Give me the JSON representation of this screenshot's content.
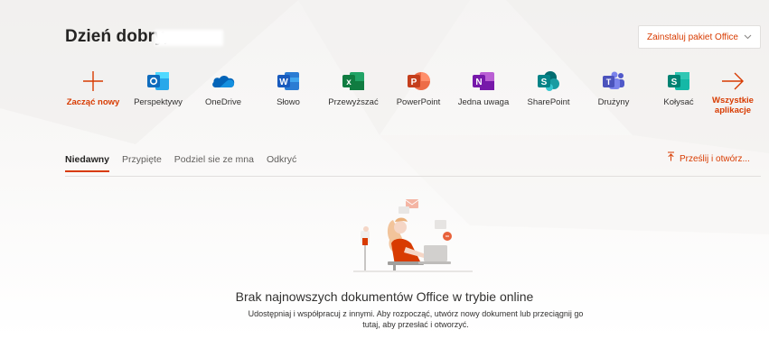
{
  "header": {
    "greeting": "Dzień dobry,",
    "install_label": "Zainstaluj pakiet Office",
    "install_chevron": "chevron-down-icon"
  },
  "apps": [
    {
      "id": "new",
      "label": "Zacząć nowy",
      "icon": "plus-icon",
      "color": "#d83b01"
    },
    {
      "id": "outlook",
      "label": "Perspektywy",
      "icon": "outlook-icon",
      "letter": "o",
      "color": "#0f6cbd"
    },
    {
      "id": "onedrive",
      "label": "OneDrive",
      "icon": "onedrive-icon",
      "color": "#0364b8"
    },
    {
      "id": "word",
      "label": "Słowo",
      "icon": "word-icon",
      "letter": "W",
      "color": "#185abd"
    },
    {
      "id": "excel",
      "label": "Przewyższać",
      "icon": "excel-icon",
      "letter": "x",
      "color": "#107c41"
    },
    {
      "id": "powerpoint",
      "label": "PowerPoint",
      "icon": "powerpoint-icon",
      "letter": "P",
      "color": "#c43e1c"
    },
    {
      "id": "onenote",
      "label": "Jedna uwaga",
      "icon": "onenote-icon",
      "letter": "N",
      "color": "#7719aa"
    },
    {
      "id": "sharepoint",
      "label": "SharePoint",
      "icon": "sharepoint-icon",
      "letter": "S",
      "color": "#038387"
    },
    {
      "id": "teams",
      "label": "Drużyny",
      "icon": "teams-icon",
      "letter": "T",
      "color": "#5059c9"
    },
    {
      "id": "sway",
      "label": "Kołysać",
      "icon": "sway-icon",
      "letter": "S",
      "color": "#008272"
    },
    {
      "id": "all",
      "label": "Wszystkie aplikacje",
      "icon": "arrow-right-icon",
      "color": "#d83b01"
    }
  ],
  "tabs": [
    {
      "label": "Niedawny",
      "active": true
    },
    {
      "label": "Przypięte",
      "active": false
    },
    {
      "label": "Podziel sie ze mna",
      "active": false
    },
    {
      "label": "Odkryć",
      "active": false
    }
  ],
  "upload": {
    "label": "Prześlij i otwórz...",
    "icon": "upload-icon"
  },
  "empty_state": {
    "title": "Brak najnowszych dokumentów Office w trybie online",
    "description": "Udostępniaj i współpracuj z innymi. Aby rozpocząć, utwórz nowy dokument lub przeciągnij go tutaj, aby przesłać i otworzyć."
  },
  "colors": {
    "accent": "#d83b01",
    "text": "#323130",
    "muted": "#605e5c"
  }
}
